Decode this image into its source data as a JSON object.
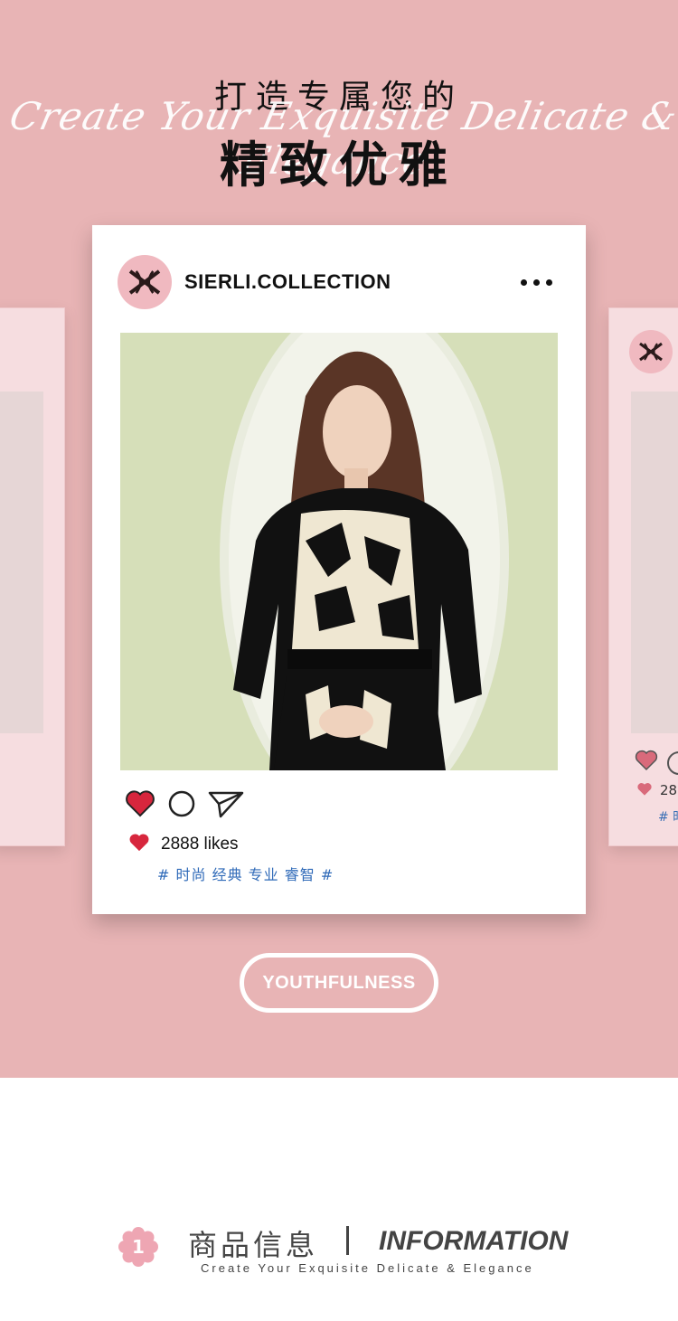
{
  "header": {
    "title_line1": "打造专属您的",
    "script_line": "Create Your Exquisite Delicate & Elegance",
    "title_line2": "精致优雅"
  },
  "post": {
    "account_name": "SIERLI.COLLECTION",
    "likes_text": "2888 likes",
    "hashtags": "# 时尚 经典 专业 睿智 #"
  },
  "side_card_right": {
    "likes_partial": "28",
    "tag_partial": "# 时"
  },
  "badge": {
    "label": "YOUTHFULNESS"
  },
  "info_section": {
    "number": "1",
    "title_cn": "商品信息",
    "title_en": "INFORMATION",
    "subtitle": "Create Your Exquisite Delicate & Elegance"
  },
  "colors": {
    "hero_bg": "#e8b4b5",
    "card_bg": "#ffffff",
    "heart_red": "#d7263d",
    "hashtag_blue": "#2f6ab8",
    "logo_pink": "#f0b9c0"
  },
  "icons": {
    "like": "heart-icon",
    "comment": "circle-comment-icon",
    "share": "paper-plane-icon",
    "more": "more-dots-icon"
  }
}
